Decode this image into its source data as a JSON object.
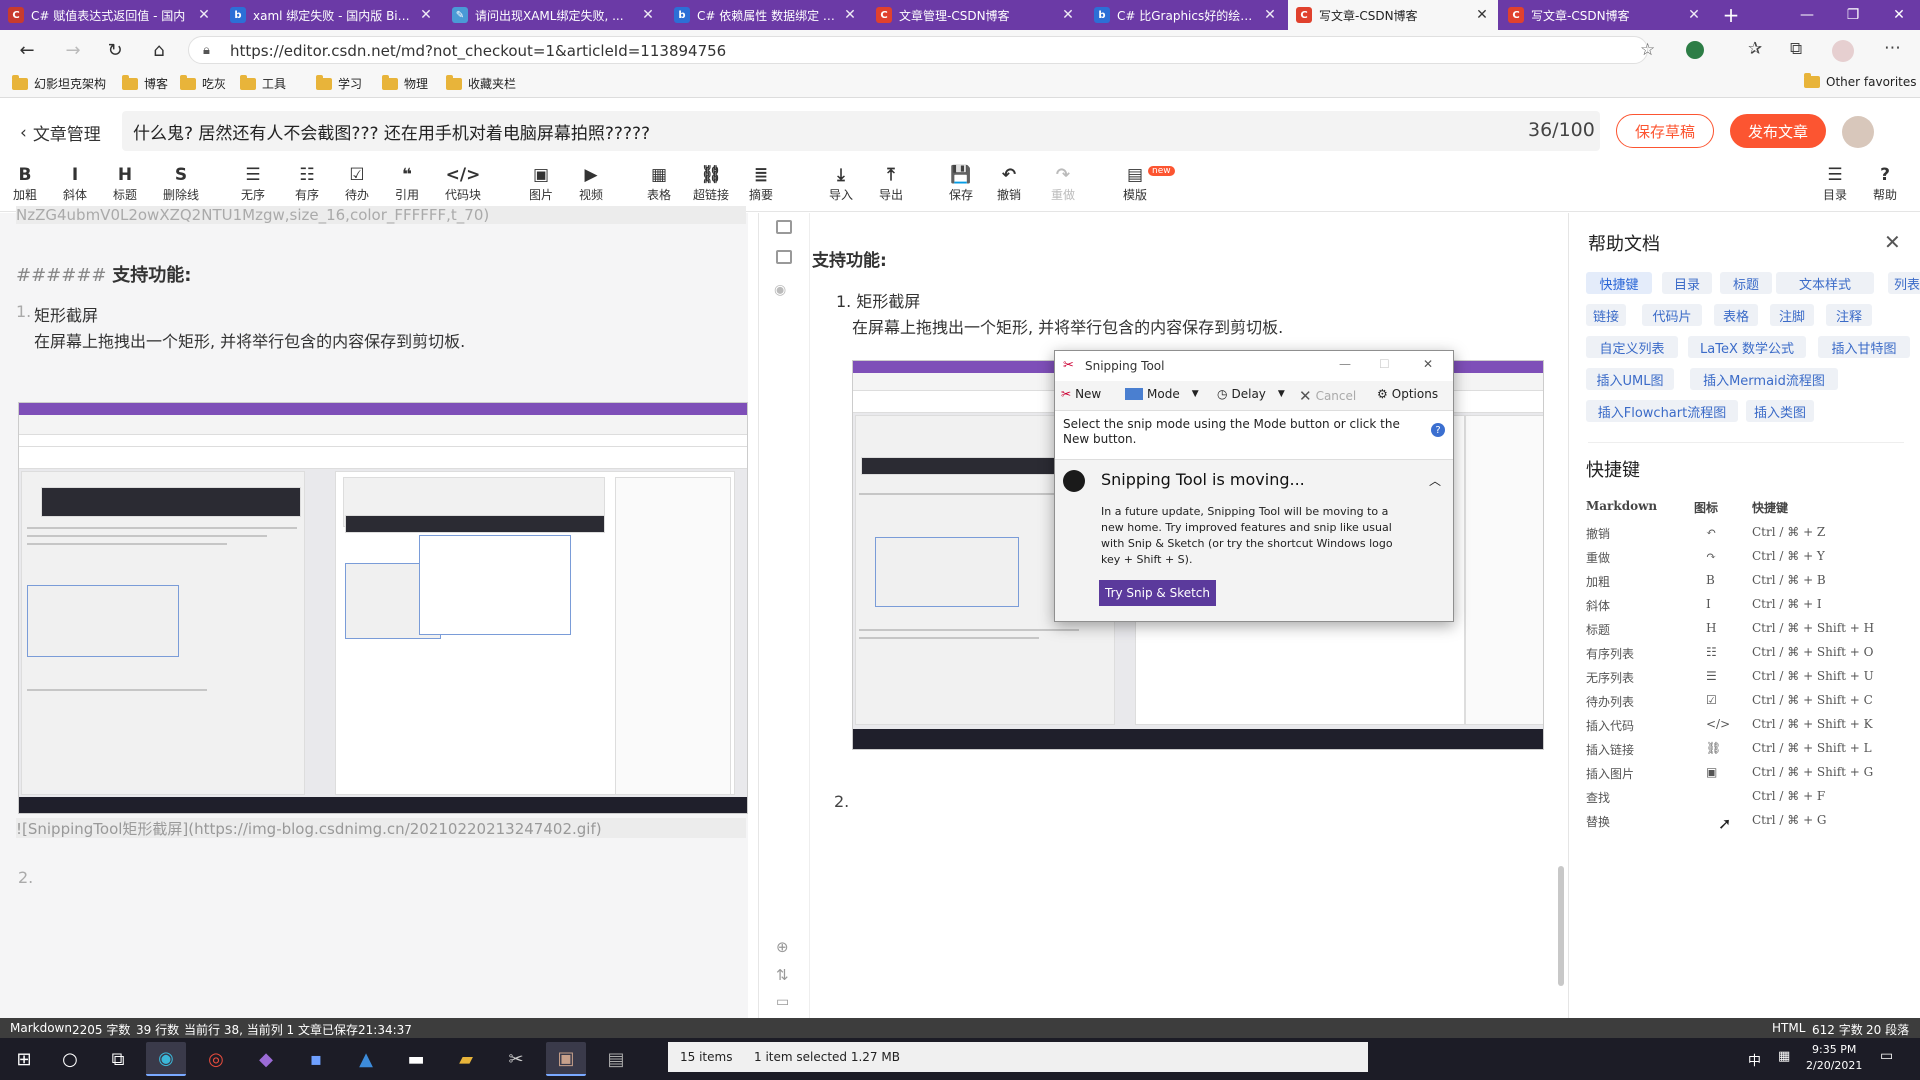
{
  "browser": {
    "tabs": [
      {
        "title": "C# 赋值表达式返回值 - 国内",
        "fav": "C",
        "color": "#c83b2e"
      },
      {
        "title": "xaml 绑定失败 - 国内版 Bing",
        "fav": "b",
        "color": "#2c6fd6"
      },
      {
        "title": "请问出现XAML绑定失败, ...",
        "fav": "✎",
        "color": "#4a9ad6"
      },
      {
        "title": "C# 依赖属性 数据绑定 - 国内",
        "fav": "b",
        "color": "#2c6fd6"
      },
      {
        "title": "文章管理-CSDN博客",
        "fav": "C",
        "color": "#e0412d"
      },
      {
        "title": "C# 比Graphics好的绘图库",
        "fav": "b",
        "color": "#2c6fd6"
      },
      {
        "title": "写文章-CSDN博客",
        "fav": "C",
        "color": "#e0412d",
        "active": true
      },
      {
        "title": "写文章-CSDN博客",
        "fav": "C",
        "color": "#e0412d"
      }
    ],
    "new_tab": "+",
    "window_buttons": [
      "—",
      "❐",
      "✕"
    ],
    "url": "https://editor.csdn.net/md?not_checkout=1&articleId=113894756",
    "bookmarks": [
      "幻影坦克架构",
      "博客",
      "吃灰",
      "工具",
      "学习",
      "物理",
      "收藏夹栏"
    ],
    "other_favorites": "Other favorites"
  },
  "header": {
    "back_label": "文章管理",
    "title": "什么鬼? 居然还有人不会截图??? 还在用手机对着电脑屏幕拍照?????",
    "counter": "36/100",
    "save_draft": "保存草稿",
    "publish": "发布文章"
  },
  "toolbar": {
    "left": [
      {
        "icon": "B",
        "label": "加粗"
      },
      {
        "icon": "I",
        "label": "斜体"
      },
      {
        "icon": "H",
        "label": "标题"
      },
      {
        "icon": "S",
        "label": "删除线"
      },
      {
        "icon": "☰",
        "label": "无序"
      },
      {
        "icon": "☷",
        "label": "有序"
      },
      {
        "icon": "☑",
        "label": "待办"
      },
      {
        "icon": "❝",
        "label": "引用"
      },
      {
        "icon": "</>",
        "label": "代码块"
      },
      {
        "icon": "▣",
        "label": "图片"
      },
      {
        "icon": "▶",
        "label": "视频"
      },
      {
        "icon": "▦",
        "label": "表格"
      },
      {
        "icon": "⛓",
        "label": "超链接"
      },
      {
        "icon": "≣",
        "label": "摘要"
      },
      {
        "icon": "⤓",
        "label": "导入"
      },
      {
        "icon": "⤒",
        "label": "导出"
      },
      {
        "icon": "💾",
        "label": "保存"
      },
      {
        "icon": "↶",
        "label": "撤销"
      },
      {
        "icon": "↷",
        "label": "重做"
      },
      {
        "icon": "▤",
        "label": "模版"
      }
    ],
    "new_badge": "new",
    "right": [
      {
        "icon": "☰",
        "label": "目录"
      },
      {
        "icon": "?",
        "label": "帮助"
      }
    ]
  },
  "editor": {
    "top_fragment": "NzZG4ubmV0L2owXZQ2NTU1Mzgw,size_16,color_FFFFFF,t_70)",
    "heading_marks": "######",
    "heading": "支持功能:",
    "item_number": "1.",
    "item_title": "矩形截屏",
    "item_desc": "在屏幕上拖拽出一个矩形, 并将举行包含的内容保存到剪切板.",
    "image_md": "![SnippingTool矩形截屏](https://img-blog.csdnimg.cn/20210220213247402.gif)",
    "item2": "2."
  },
  "preview": {
    "heading": "支持功能:",
    "item_title": "1. 矩形截屏",
    "item_desc": "在屏幕上拖拽出一个矩形, 并将举行包含的内容保存到剪切板.",
    "item2": "2."
  },
  "snipping_tool": {
    "title": "Snipping Tool",
    "buttons": [
      "New",
      "Mode",
      "Delay",
      "Cancel",
      "Options"
    ],
    "instruction": "Select the snip mode using the Mode button or click the New button.",
    "moving_title": "Snipping Tool is moving...",
    "moving_body": "In a future update, Snipping Tool will be moving to a new home. Try improved features and snip like usual with Snip & Sketch (or try the shortcut Windows logo key + Shift + S).",
    "try_button": "Try Snip & Sketch"
  },
  "help": {
    "title": "帮助文档",
    "tags": [
      "快捷键",
      "目录",
      "标题",
      "文本样式",
      "列表",
      "链接",
      "代码片",
      "表格",
      "注脚",
      "注释",
      "自定义列表",
      "LaTeX 数学公式",
      "插入甘特图",
      "插入UML图",
      "插入Mermaid流程图",
      "插入Flowchart流程图",
      "插入类图"
    ],
    "shortcuts_title": "快捷键",
    "columns": [
      "Markdown",
      "图标",
      "快捷键"
    ],
    "rows": [
      {
        "name": "撤销",
        "icon": "↶",
        "keys": "Ctrl / ⌘ + Z"
      },
      {
        "name": "重做",
        "icon": "↷",
        "keys": "Ctrl / ⌘ + Y"
      },
      {
        "name": "加粗",
        "icon": "B",
        "keys": "Ctrl / ⌘ + B"
      },
      {
        "name": "斜体",
        "icon": "I",
        "keys": "Ctrl / ⌘ + I"
      },
      {
        "name": "标题",
        "icon": "H",
        "keys": "Ctrl / ⌘ + Shift + H"
      },
      {
        "name": "有序列表",
        "icon": "☷",
        "keys": "Ctrl / ⌘ + Shift + O"
      },
      {
        "name": "无序列表",
        "icon": "☰",
        "keys": "Ctrl / ⌘ + Shift + U"
      },
      {
        "name": "待办列表",
        "icon": "☑",
        "keys": "Ctrl / ⌘ + Shift + C"
      },
      {
        "name": "插入代码",
        "icon": "</>",
        "keys": "Ctrl / ⌘ + Shift + K"
      },
      {
        "name": "插入链接",
        "icon": "⛓",
        "keys": "Ctrl / ⌘ + Shift + L"
      },
      {
        "name": "插入图片",
        "icon": "▣",
        "keys": "Ctrl / ⌘ + Shift + G"
      },
      {
        "name": "查找",
        "icon": "",
        "keys": "Ctrl / ⌘ + F"
      },
      {
        "name": "替换",
        "icon": "",
        "keys": "Ctrl / ⌘ + G"
      }
    ]
  },
  "status": {
    "mode": "Markdown",
    "chars": "2205 字数",
    "lines": "39 行数",
    "cursor": "当前行 38, 当前列 1",
    "saved": "文章已保存21:34:37",
    "right_mode": "HTML",
    "right_chars": "612 字数",
    "right_paras": "20 段落"
  },
  "taskbar": {
    "explorer_items": "15 items",
    "explorer_selected": "1 item selected  1.27 MB",
    "time": "9:35 PM",
    "date": "2/20/2021",
    "ime": "中"
  },
  "colors": {
    "tab_bar": "#6b3aa6",
    "publish": "#fc5531",
    "link": "#2a66d6"
  }
}
